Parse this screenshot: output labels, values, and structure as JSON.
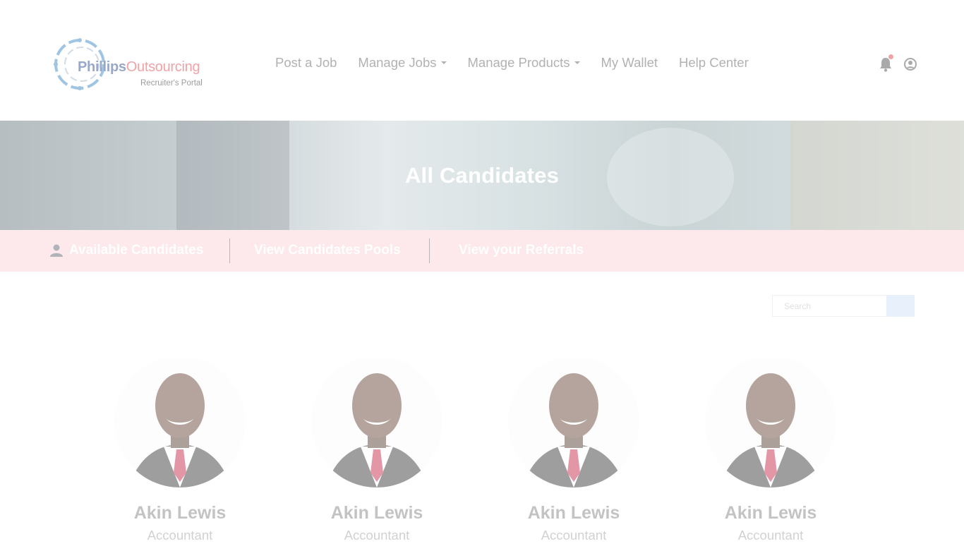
{
  "header": {
    "logo": {
      "brand_part1": "Phillips",
      "brand_part2": "Outsourcing",
      "tagline": "Recruiter's Portal"
    },
    "nav": [
      {
        "label": "Post a Job",
        "has_dropdown": false
      },
      {
        "label": "Manage Jobs",
        "has_dropdown": true
      },
      {
        "label": "Manage Products",
        "has_dropdown": true
      },
      {
        "label": "My Wallet",
        "has_dropdown": false
      },
      {
        "label": "Help Center",
        "has_dropdown": false
      }
    ],
    "icons": [
      "bell-icon",
      "user-circle-icon"
    ]
  },
  "hero": {
    "title": "All Candidates"
  },
  "tabs": [
    {
      "label": "Available Candidates",
      "icon": "user-icon"
    },
    {
      "label": "View Candidates Pools"
    },
    {
      "label": "View your Referrals"
    }
  ],
  "search": {
    "placeholder": "Search"
  },
  "candidates": [
    {
      "name": "Akin Lewis",
      "role": "Accountant"
    },
    {
      "name": "Akin Lewis",
      "role": "Accountant"
    },
    {
      "name": "Akin Lewis",
      "role": "Accountant"
    },
    {
      "name": "Akin Lewis",
      "role": "Accountant"
    }
  ],
  "colors": {
    "brand_blue": "#1b3f8a",
    "brand_red": "#e0323a",
    "tab_strip": "#fde9ec",
    "search_button": "#e8f0fb"
  }
}
